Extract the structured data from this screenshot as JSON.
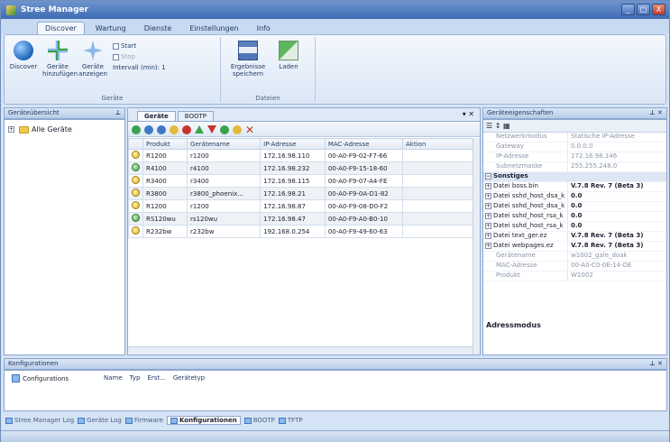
{
  "window": {
    "title": "Stree Manager",
    "buttons": [
      "_",
      "□",
      "X"
    ]
  },
  "ribbon": {
    "tabs": [
      "Discover",
      "Wartung",
      "Dienste",
      "Einstellungen",
      "Info"
    ],
    "active_tab": "Discover",
    "discover_label": "Discover",
    "add_device_label": "Geräte hinzufügen",
    "show_devices_label": "Geräte anzeigen",
    "start_label": "Start",
    "stop_label": "Stop",
    "interval_label": "Intervall (min):",
    "interval_value": "1",
    "group_devices": "Geräte",
    "save_results_label": "Ergebnisse speichern",
    "load_label": "Laden",
    "group_data": "Dateien"
  },
  "left_pane": {
    "title": "Geräteübersicht",
    "tree_root": "Alle Geräte"
  },
  "center": {
    "tabs": [
      "Geräte",
      "BOOTP"
    ],
    "columns": [
      "Produkt",
      "Gerätename",
      "IP-Adresse",
      "MAC-Adresse",
      "Aktion"
    ],
    "rows": [
      {
        "status": "yellow",
        "product": "R1200",
        "name": "r1200",
        "ip": "172.16.98.110",
        "mac": "00-A0-F9-02-F7-66",
        "action": ""
      },
      {
        "status": "green",
        "product": "R4100",
        "name": "r4100",
        "ip": "172.16.98.232",
        "mac": "00-A0-F9-15-18-60",
        "action": ""
      },
      {
        "status": "yellow",
        "product": "R3400",
        "name": "r3400",
        "ip": "172.16.98.115",
        "mac": "00-A0-F9-07-A4-FE",
        "action": ""
      },
      {
        "status": "yellow",
        "product": "R3800",
        "name": "r3800_phoenix...",
        "ip": "172.16.98.21",
        "mac": "00-A0-F9-0A-D1-82",
        "action": ""
      },
      {
        "status": "yellow",
        "product": "R1200",
        "name": "r1200",
        "ip": "172.16.98.87",
        "mac": "00-A0-F9-08-D0-F2",
        "action": ""
      },
      {
        "status": "green",
        "product": "RS120wu",
        "name": "rs120wu",
        "ip": "172.16.98.47",
        "mac": "00-A0-F9-A0-B0-10",
        "action": ""
      },
      {
        "status": "yellow",
        "product": "R232bw",
        "name": "r232bw",
        "ip": "192.168.0.254",
        "mac": "00-A0-F9-49-60-63",
        "action": ""
      }
    ]
  },
  "properties": {
    "title": "Geräteeigenschaften",
    "rows": [
      {
        "key": "Netzwerkmodus",
        "value": "Statische IP-Adresse",
        "kind": "dim"
      },
      {
        "key": "Gateway",
        "value": "0.0.0.0",
        "kind": "dim"
      },
      {
        "key": "IP-Adresse",
        "value": "172.16.98.146",
        "kind": "dim"
      },
      {
        "key": "Subnetzmaske",
        "value": "255.255.248.0",
        "kind": "dim"
      },
      {
        "key": "Sonstiges",
        "value": "",
        "kind": "cat"
      },
      {
        "key": "Datei boss.bin",
        "value": "V.7.8 Rev. 7 (Beta 3)",
        "kind": "bold"
      },
      {
        "key": "Datei sshd_host_dsa_k",
        "value": "0.0",
        "kind": "bold"
      },
      {
        "key": "Datei sshd_host_dsa_k",
        "value": "0.0",
        "kind": "bold"
      },
      {
        "key": "Datei sshd_host_rsa_k",
        "value": "0.0",
        "kind": "bold"
      },
      {
        "key": "Datei sshd_host_rsa_k",
        "value": "0.0",
        "kind": "bold"
      },
      {
        "key": "Datei text_ger.ez",
        "value": "V.7.8 Rev. 7 (Beta 3)",
        "kind": "bold"
      },
      {
        "key": "Datei webpages.ez",
        "value": "V.7.8 Rev. 7 (Beta 3)",
        "kind": "bold"
      },
      {
        "key": "Gerätename",
        "value": "w1002_gale_doak",
        "kind": "dim"
      },
      {
        "key": "MAC-Adresse",
        "value": "00-A0-C0-0E-14-DE",
        "kind": "dim"
      },
      {
        "key": "Produkt",
        "value": "W1002",
        "kind": "dim"
      }
    ],
    "description": "Adressmodus"
  },
  "bottom": {
    "title": "Konfigurationen",
    "item": "Configurations",
    "columns": [
      "Name",
      "Typ",
      "Erst...",
      "Gerätetyp"
    ],
    "tabs": [
      "Stree Manager Log",
      "Geräte Log",
      "Firmware",
      "Konfigurationen",
      "BOOTP",
      "TFTP"
    ],
    "active_tab": "Konfigurationen"
  }
}
